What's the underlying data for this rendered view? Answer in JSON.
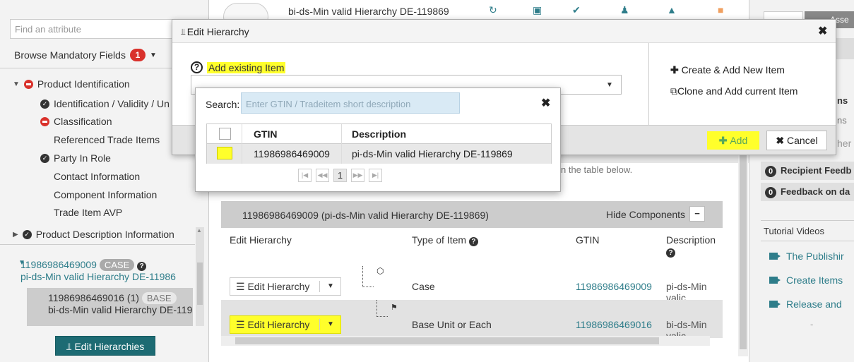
{
  "sidebar": {
    "search_placeholder": "Find an attribute",
    "browse_label": "Browse Mandatory Fields",
    "browse_count": "1",
    "tree": [
      {
        "label": "Product Identification"
      },
      {
        "label": "Identification / Validity / Un"
      },
      {
        "label": "Classification"
      },
      {
        "label": "Referenced Trade Items"
      },
      {
        "label": "Party In Role"
      },
      {
        "label": "Contact Information"
      },
      {
        "label": "Component Information"
      },
      {
        "label": "Trade Item AVP"
      },
      {
        "label": "Product Description Information"
      }
    ],
    "hier_node1": {
      "gtin": "11986986469009",
      "badge": "CASE",
      "desc": "pi-ds-Min valid Hierarchy DE-11986"
    },
    "hier_node2": {
      "gtin": "11986986469016 (1)",
      "badge": "BASE",
      "desc": "bi-ds-Min valid Hierarchy DE-119"
    },
    "edit_hierarchies_label": "Edit Hierarchies"
  },
  "main": {
    "title": "bi-ds-Min valid Hierarchy DE-119869",
    "hint": "n the table below.",
    "grid_header": "11986986469009 (pi-ds-Min valid Hierarchy DE-119869)",
    "hide_components": "Hide Components",
    "columns": [
      "Edit Hierarchy",
      "Type of Item",
      "GTIN",
      "Description"
    ],
    "rows": [
      {
        "button": "Edit Hierarchy",
        "type": "Case",
        "gtin": "11986986469009",
        "desc": "pi-ds-Min valic"
      },
      {
        "button": "Edit Hierarchy",
        "type": "Base Unit or Each",
        "gtin": "11986986469016",
        "desc": "bi-ds-Min valic"
      }
    ]
  },
  "right": {
    "tab_label": "Asse",
    "line_ns": "ns",
    "line_ns2": "ns",
    "line_her": "her",
    "feedback": [
      {
        "count": "0",
        "label": "Recipient Feedb"
      },
      {
        "count": "0",
        "label": "Feedback on da"
      }
    ],
    "tutorial_head": "Tutorial Videos",
    "tutorials": [
      "The Publishir",
      "Create Items",
      "Release and"
    ],
    "dash": "-"
  },
  "dialog": {
    "title": "Edit Hierarchy",
    "add_existing": "Add existing Item",
    "create_new": "Create & Add New Item",
    "clone_add": "Clone and Add current Item",
    "add_btn": "Add",
    "cancel_btn": "Cancel"
  },
  "popup": {
    "search_label": "Search:",
    "search_placeholder": "Enter GTIN / Tradeitem short description",
    "columns": [
      "GTIN",
      "Description"
    ],
    "rows": [
      {
        "gtin": "11986986469009",
        "desc": "pi-ds-Min valid Hierarchy DE-119869"
      }
    ],
    "page": "1"
  },
  "colors": {
    "accent": "#1d6b73",
    "link": "#2e7d8a",
    "highlight": "#ffff2b",
    "error": "#d9312b"
  }
}
